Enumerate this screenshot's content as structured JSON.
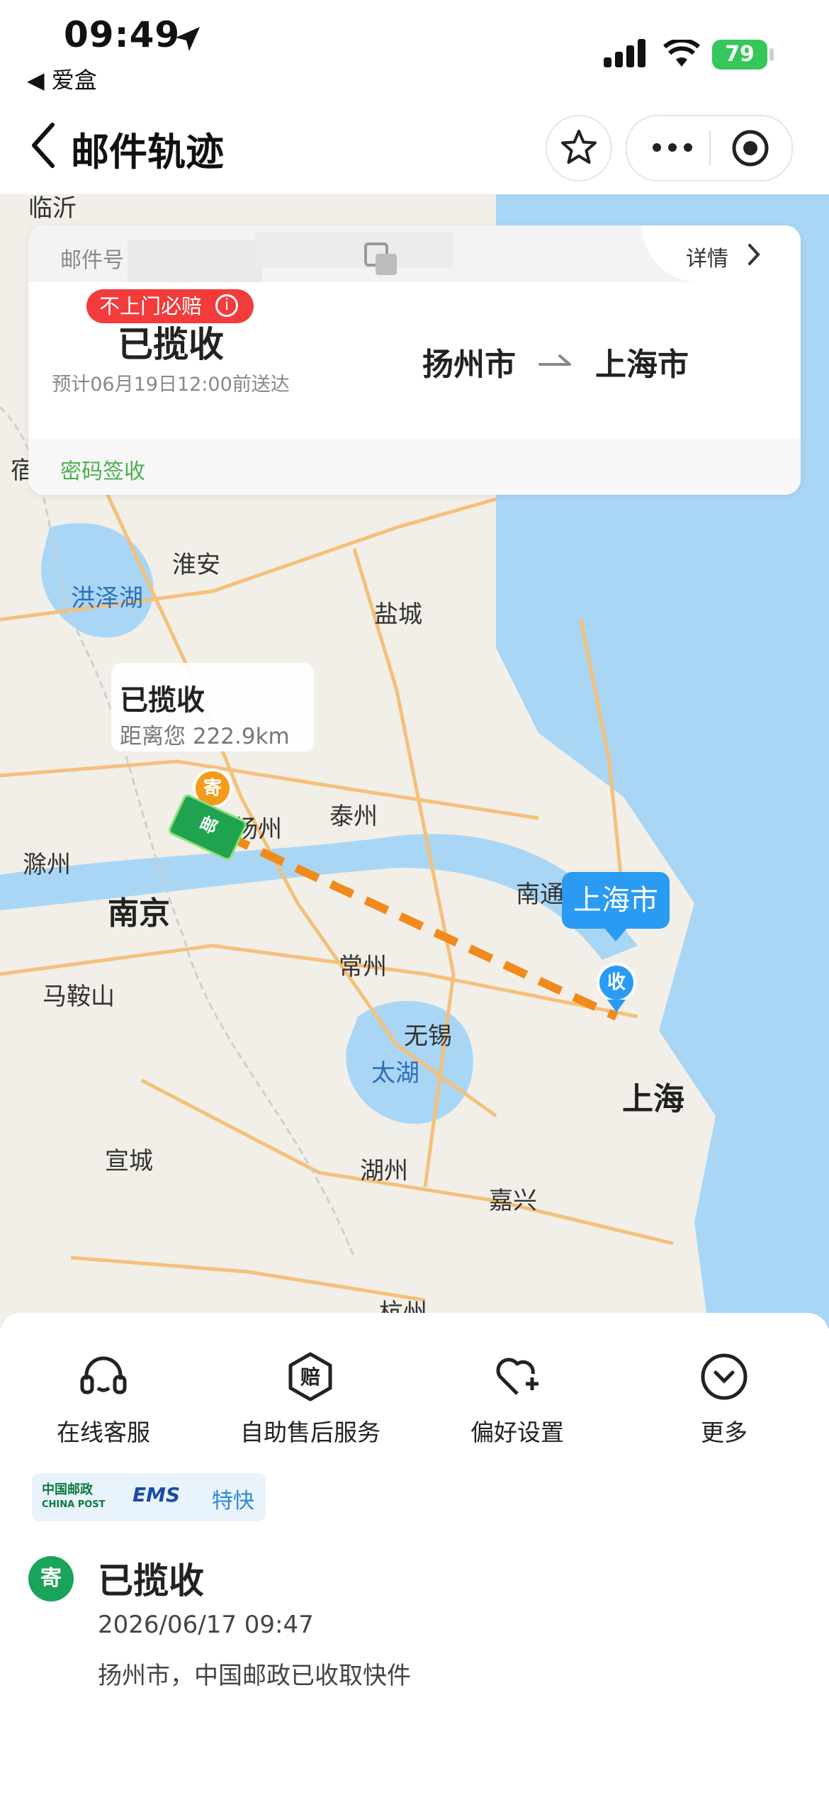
{
  "status_bar": {
    "time": "09:49",
    "back_app": "◀ 爱盒",
    "battery": "79"
  },
  "nav": {
    "title": "邮件轨迹"
  },
  "info_card": {
    "mail_label": "邮件号",
    "detail_label": "详情",
    "badge": "不上门必赔",
    "state": "已揽收",
    "eta": "预计06月19日12:00前送达",
    "from_city": "扬州市",
    "to_city": "上海市",
    "password_sign": "密码签收"
  },
  "map": {
    "labels": [
      {
        "text": "临沂",
        "cls": ""
      },
      {
        "text": "宿",
        "cls": ""
      },
      {
        "text": "淮安",
        "cls": ""
      },
      {
        "text": "洪泽湖",
        "cls": "water"
      },
      {
        "text": "盐城",
        "cls": ""
      },
      {
        "text": "泰州",
        "cls": ""
      },
      {
        "text": "扬州",
        "cls": ""
      },
      {
        "text": "滁州",
        "cls": ""
      },
      {
        "text": "南京",
        "cls": "big"
      },
      {
        "text": "南通",
        "cls": ""
      },
      {
        "text": "常州",
        "cls": ""
      },
      {
        "text": "马鞍山",
        "cls": ""
      },
      {
        "text": "无锡",
        "cls": ""
      },
      {
        "text": "太湖",
        "cls": "water"
      },
      {
        "text": "上海",
        "cls": "big"
      },
      {
        "text": "宣城",
        "cls": ""
      },
      {
        "text": "湖州",
        "cls": ""
      },
      {
        "text": "嘉兴",
        "cls": ""
      },
      {
        "text": "杭州",
        "cls": ""
      }
    ],
    "popup_title": "已揽收",
    "popup_distance": "距离您 222.9km",
    "sender_marker": "寄",
    "receiver_marker": "收",
    "truck_text": "邮",
    "callout": "上海市"
  },
  "actions": [
    {
      "label": "在线客服",
      "icon": "headset-icon"
    },
    {
      "label": "自助售后服务",
      "icon": "compensation-icon"
    },
    {
      "label": "偏好设置",
      "icon": "heart-plus-icon"
    },
    {
      "label": "更多",
      "icon": "chevron-circle-icon"
    }
  ],
  "brand": {
    "post_cn": "中国邮政",
    "post_en": "CHINA POST",
    "ems": "EMS",
    "service": "特快"
  },
  "timeline": [
    {
      "marker": "寄",
      "state": "已揽收",
      "time": "2026/06/17 09:47",
      "desc": "扬州市，中国邮政已收取快件"
    }
  ],
  "colors": {
    "route": "#f08a1c",
    "water": "#a9d6f5",
    "accent_green": "#1aa35a",
    "badge_red": "#f23b3b",
    "callout_blue": "#2a9bf2"
  }
}
